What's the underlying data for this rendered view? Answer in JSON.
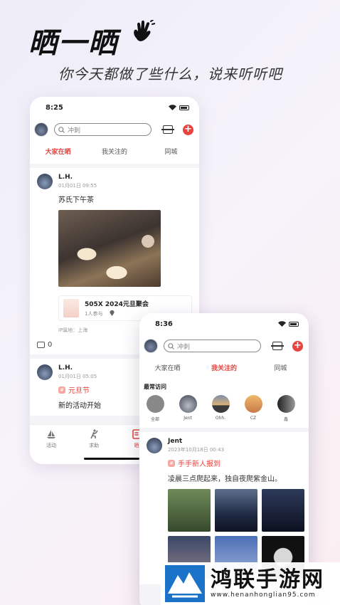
{
  "headline": "晒一晒",
  "subline": "你今天都做了些什么，说来听听吧",
  "phone1": {
    "time": "8:25",
    "search_placeholder": "冲刺",
    "tabs": [
      "大家在晒",
      "我关注的",
      "同城"
    ],
    "post1": {
      "name": "L.H.",
      "time": "01月01日 09:55",
      "text": "苏氏下午茶",
      "event_title": "505X 2024元旦聚会",
      "event_participants": "1人参与",
      "ip": "IP属地：上海",
      "comments": "0"
    },
    "post2": {
      "name": "L.H.",
      "time": "01月01日 05:05",
      "tag": "元旦节",
      "text": "新的活动开始"
    },
    "nav": [
      "活动",
      "求助",
      "晒"
    ]
  },
  "phone2": {
    "time": "8:36",
    "search_placeholder": "冲刺",
    "tabs": [
      "大家在晒",
      "我关注的",
      "同城"
    ],
    "section_title": "最常访问",
    "recent": [
      "全部",
      "Jent",
      "Ohh.",
      "CZ",
      "鑫"
    ],
    "post": {
      "name": "Jent",
      "time": "2023年10月18日 00:43",
      "tag": "手手新人报到",
      "text": "凌晨三点爬起来，独自夜爬紫金山。"
    }
  },
  "watermark": {
    "name": "鸿联手游网",
    "url": "www.henanhonglian95.com"
  }
}
